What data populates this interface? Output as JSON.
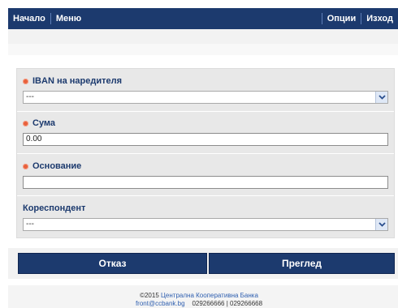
{
  "nav": {
    "left": [
      "Начало",
      "Меню"
    ],
    "right": [
      "Опции",
      "Изход"
    ]
  },
  "form": {
    "payer_iban": {
      "label": "IBAN на наредителя",
      "value": "---"
    },
    "amount": {
      "label": "Сума",
      "value": "0.00"
    },
    "reason": {
      "label": "Основание",
      "value": ""
    },
    "correspondent": {
      "label": "Кореспондент",
      "value": "---"
    }
  },
  "buttons": {
    "cancel": "Отказ",
    "preview": "Преглед"
  },
  "footer": {
    "copyright": "©2015",
    "bank_name": "Централна Кооперативна Банка",
    "email": "front@ccbank.bg",
    "phones": "029266666 | 029266668"
  },
  "colors": {
    "brand": "#1c3a6e",
    "required": "#e8603c"
  }
}
